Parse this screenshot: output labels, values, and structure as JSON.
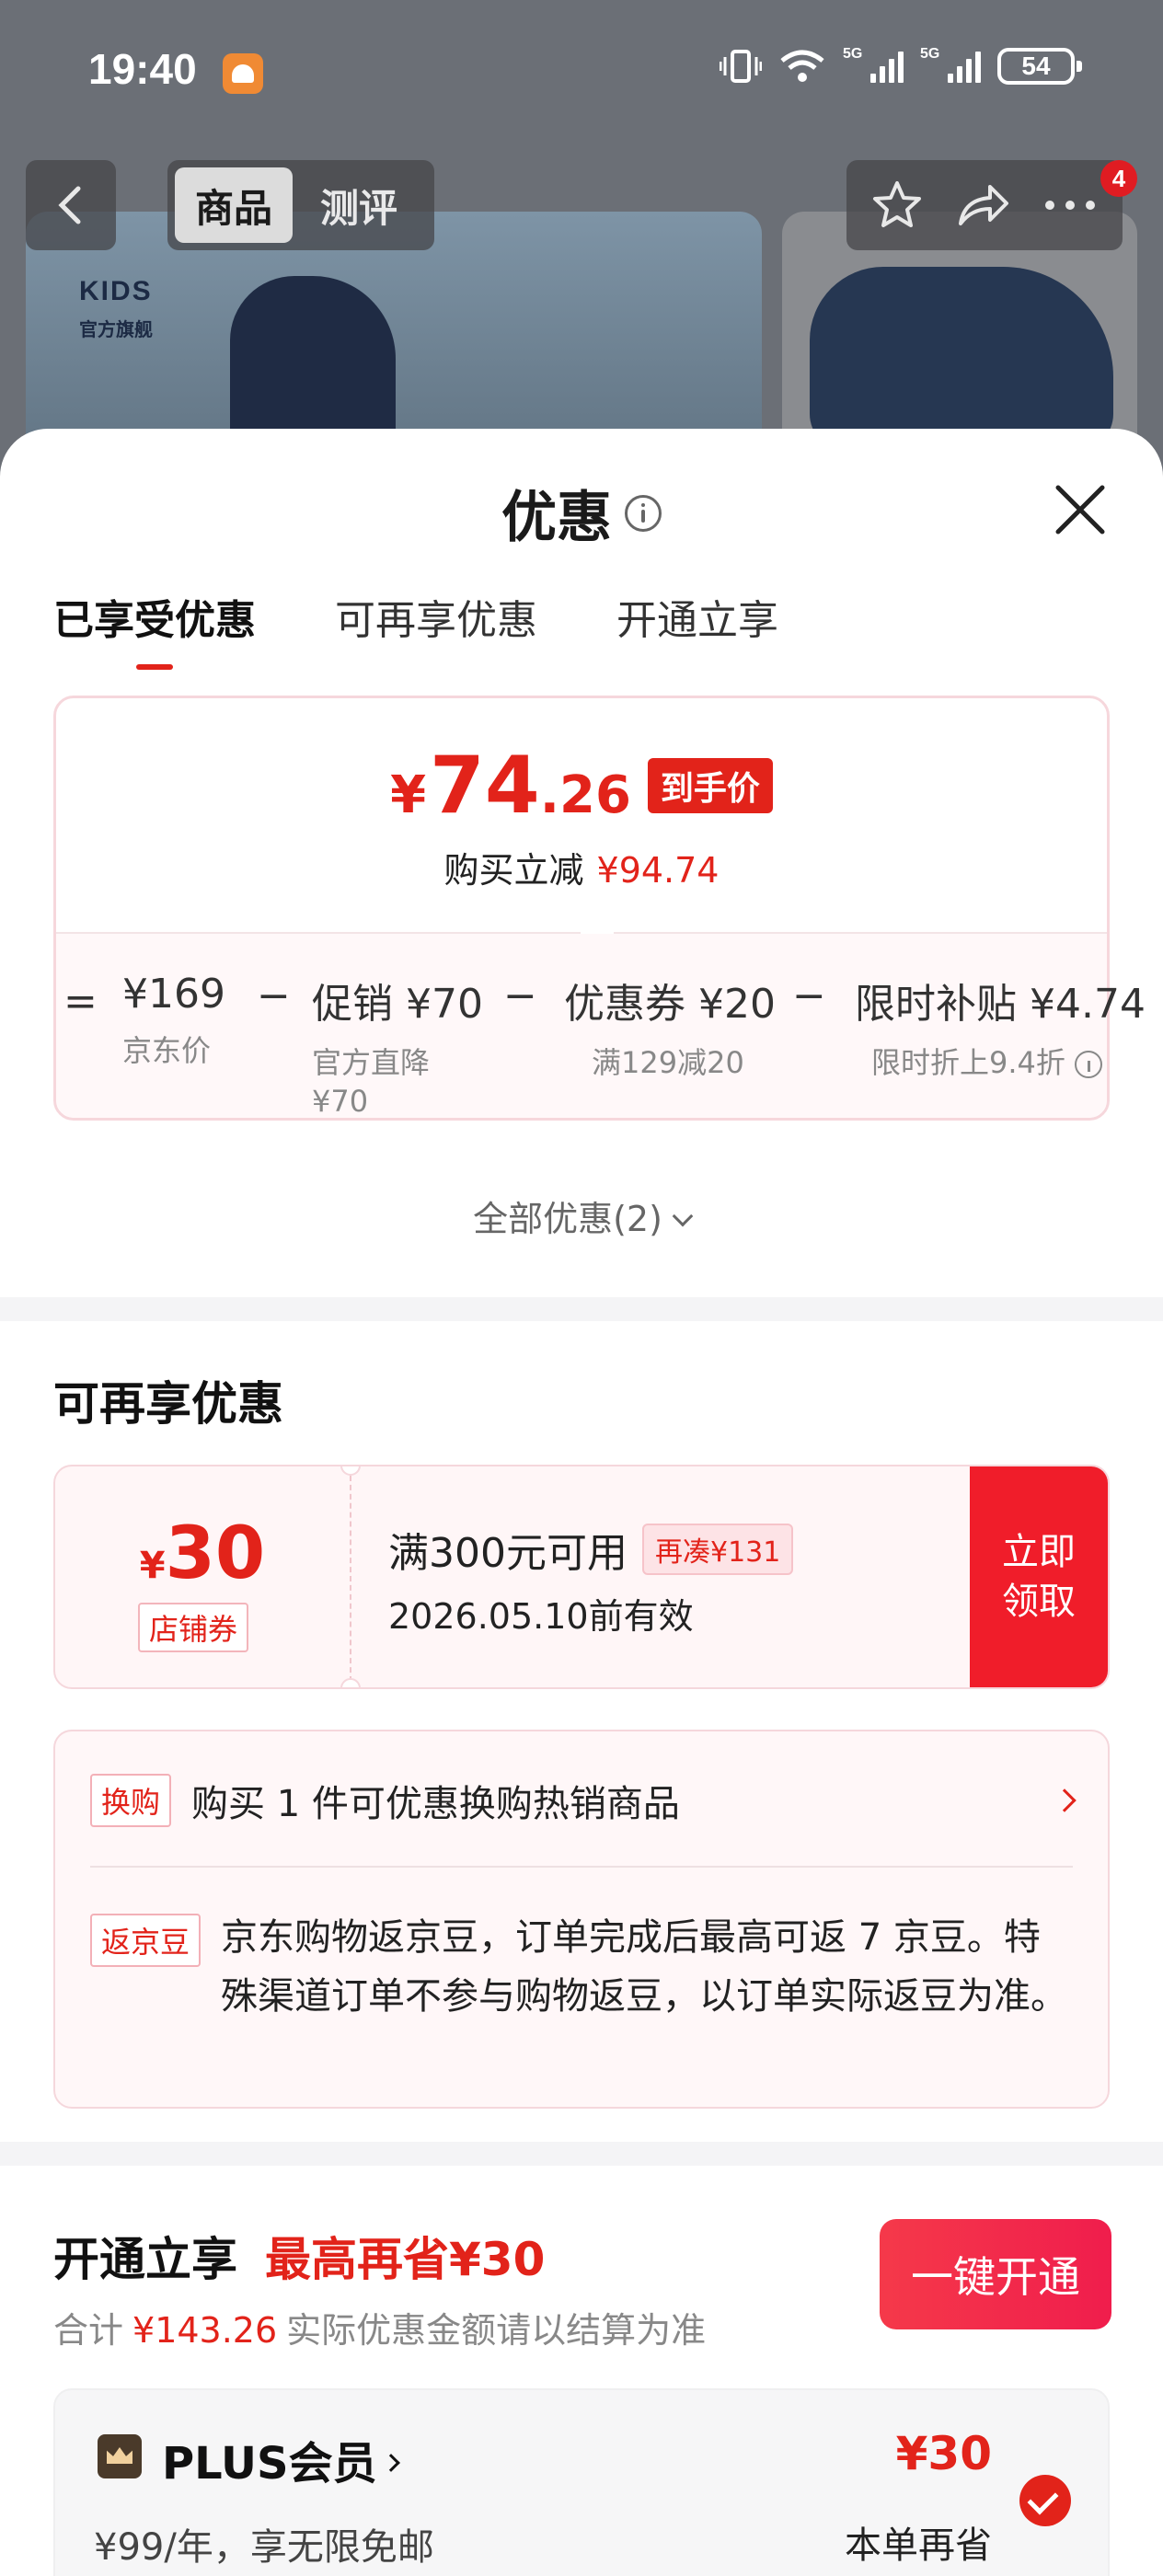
{
  "status_bar": {
    "time": "19:40",
    "network_1": "5G",
    "network_2": "5G",
    "battery": "54"
  },
  "top_nav": {
    "tabs": [
      {
        "label": "商品",
        "active": true
      },
      {
        "label": "测评",
        "active": false
      }
    ],
    "notification_count": "4"
  },
  "background": {
    "brand_logo": "KIDS",
    "brand_sub": "官方旗舰"
  },
  "sheet": {
    "title": "优惠",
    "tabs": [
      {
        "label": "已享受优惠",
        "active": true
      },
      {
        "label": "可再享优惠",
        "active": false
      },
      {
        "label": "开通立享",
        "active": false
      }
    ],
    "price": {
      "currency": "¥",
      "integer": "74",
      "decimal": ".26",
      "badge": "到手价",
      "discount_label": "购买立减",
      "discount_value": "¥94.74"
    },
    "breakdown": [
      {
        "value": "¥169",
        "note": "京东价"
      },
      {
        "value": "促销 ¥70",
        "note": "官方直降",
        "note2": "¥70"
      },
      {
        "value": "优惠券 ¥20",
        "note": "满129减20"
      },
      {
        "value": "限时补贴 ¥4.74",
        "note": "限时折上9.4折"
      }
    ],
    "equals_sign": "=",
    "minus_sign": "−",
    "all_deals": "全部优惠(2)",
    "more_section": {
      "title": "可再享优惠",
      "coupon": {
        "currency": "¥",
        "amount": "30",
        "type": "店铺券",
        "condition": "满300元可用",
        "more_needed": "再凑¥131",
        "valid_until": "2026.05.10前有效",
        "claim_line1": "立即",
        "claim_line2": "领取"
      },
      "exchange": {
        "tag": "换购",
        "text": "购买 1 件可优惠换购热销商品"
      },
      "beans": {
        "tag": "返京豆",
        "text": "京东购物返京豆，订单完成后最高可返 7 京豆。特殊渠道订单不参与购物返豆，以订单实际返豆为准。"
      }
    },
    "open_section": {
      "title": "开通立享",
      "max_save": "最高再省¥30",
      "total_label": "合计",
      "total_value": "¥143.26",
      "total_note": "实际优惠金额请以结算为准",
      "button": "一键开通",
      "plus": {
        "name": "PLUS会员",
        "desc": "¥99/年，享无限免邮",
        "amount": "¥30",
        "save_label": "本单再省"
      }
    }
  },
  "colors": {
    "accent_red": "#e2231a",
    "claim_red": "#f01d2a",
    "coupon_bg": "#fff6f7",
    "coupon_border": "#f5d7dc"
  }
}
